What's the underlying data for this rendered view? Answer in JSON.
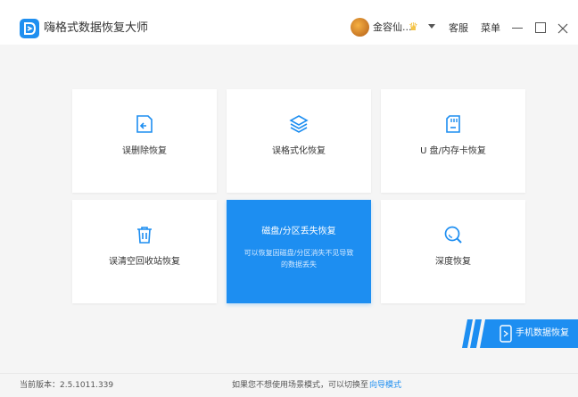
{
  "app": {
    "title": "嗨格式数据恢复大师",
    "logo_icon": "app-logo-icon",
    "accent_color": "#1d8ef1"
  },
  "header": {
    "username": "金容仙...",
    "vip_icon": "crown-icon",
    "service_label": "客服",
    "menu_label": "菜单"
  },
  "cards": [
    {
      "label": "误删除恢复",
      "icon": "file-restore-icon"
    },
    {
      "label": "误格式化恢复",
      "icon": "layers-icon"
    },
    {
      "label": "U 盘/内存卡恢复",
      "icon": "sd-card-icon"
    },
    {
      "label": "误清空回收站恢复",
      "icon": "trash-icon"
    },
    {
      "label": "磁盘/分区丢失恢复",
      "icon": "disk-icon",
      "description": "可以恢复因磁盘/分区消失不见导致的数据丢失",
      "active": true
    },
    {
      "label": "深度恢复",
      "icon": "deep-search-icon"
    }
  ],
  "mobile": {
    "label": "手机数据恢复",
    "icon": "phone-icon"
  },
  "status": {
    "version": "当前版本：2.5.1011.339",
    "hint": "如果您不想使用场景模式，可以切换至",
    "guide_link": "向导模式"
  }
}
